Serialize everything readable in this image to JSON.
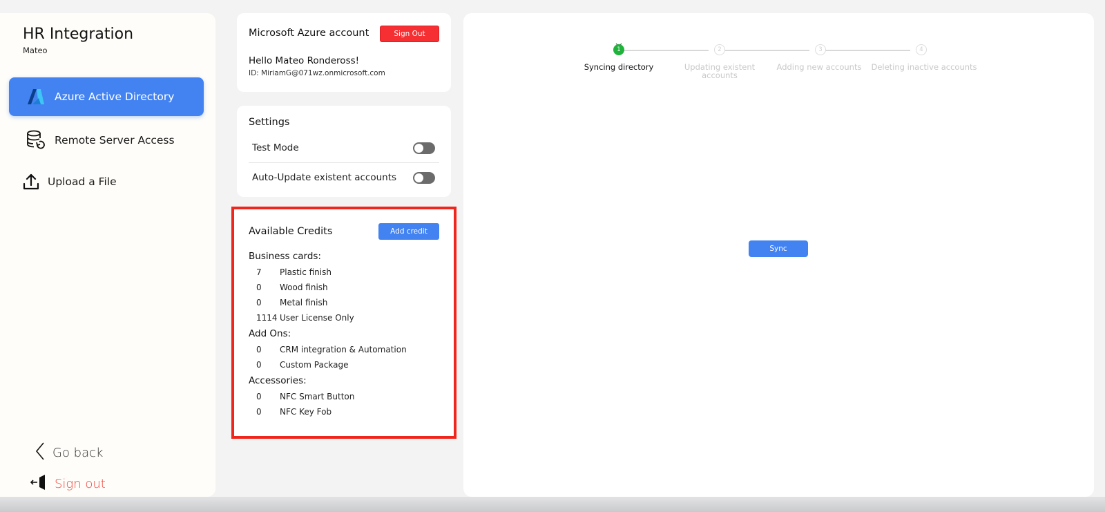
{
  "sidebar": {
    "title": "HR Integration",
    "user": "Mateo",
    "items": [
      {
        "label": "Azure Active Directory",
        "icon": "azure-logo-icon",
        "active": true
      },
      {
        "label": "Remote Server Access",
        "icon": "database-sync-icon",
        "active": false
      },
      {
        "label": "Upload a File",
        "icon": "upload-icon",
        "active": false
      }
    ],
    "go_back": "Go back",
    "sign_out": "Sign out"
  },
  "account": {
    "title": "Microsoft Azure account",
    "sign_out_button": "Sign Out",
    "hello_prefix": "Hello ",
    "name": "Mateo Rondeross!",
    "id": "ID: MiriamG@071wz.onmicrosoft.com"
  },
  "settings": {
    "title": "Settings",
    "rows": [
      {
        "label": "Test Mode",
        "enabled": false
      },
      {
        "label": "Auto-Update existent accounts",
        "enabled": false
      }
    ]
  },
  "credits": {
    "title": "Available Credits",
    "add_button": "Add credit",
    "sections": [
      {
        "label": "Business cards:",
        "items": [
          {
            "count": "7",
            "name": "Plastic finish"
          },
          {
            "count": "0",
            "name": "Wood finish"
          },
          {
            "count": "0",
            "name": "Metal finish"
          },
          {
            "count": "1114",
            "name": "User License Only"
          }
        ]
      },
      {
        "label": "Add Ons:",
        "items": [
          {
            "count": "0",
            "name": "CRM integration & Automation"
          },
          {
            "count": "0",
            "name": "Custom Package"
          }
        ]
      },
      {
        "label": "Accessories:",
        "items": [
          {
            "count": "0",
            "name": "NFC Smart Button"
          },
          {
            "count": "0",
            "name": "NFC Key Fob"
          }
        ]
      }
    ]
  },
  "stepper": {
    "steps": [
      {
        "number": "1",
        "label": "Syncing directory",
        "active": true
      },
      {
        "number": "2",
        "label": "Updating existent accounts",
        "active": false
      },
      {
        "number": "3",
        "label": "Adding new accounts",
        "active": false
      },
      {
        "number": "4",
        "label": "Deleting inactive accounts",
        "active": false
      }
    ]
  },
  "sync_button": "Sync",
  "colors": {
    "accent": "#4383f1",
    "danger": "#f62f33",
    "success": "#1fb33c",
    "highlight_border": "#f0251c"
  }
}
